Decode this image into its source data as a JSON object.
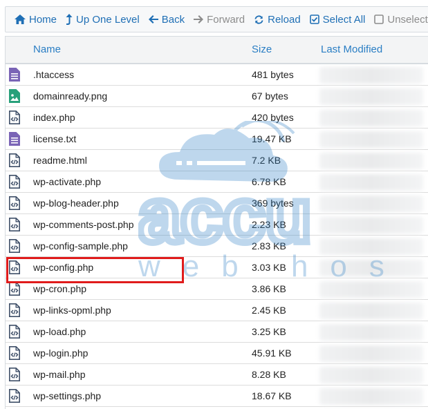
{
  "toolbar": {
    "home": "Home",
    "up": "Up One Level",
    "back": "Back",
    "forward": "Forward",
    "reload": "Reload",
    "select_all": "Select All",
    "unselect": "Unselect All"
  },
  "table": {
    "columns": {
      "name": "Name",
      "size": "Size",
      "modified": "Last Modified"
    },
    "rows": [
      {
        "name": ".htaccess",
        "size": "481 bytes",
        "icon": "text-file-icon"
      },
      {
        "name": "domainready.png",
        "size": "67 bytes",
        "icon": "image-file-icon"
      },
      {
        "name": "index.php",
        "size": "420 bytes",
        "icon": "code-file-icon"
      },
      {
        "name": "license.txt",
        "size": "19.47 KB",
        "icon": "text-file-icon"
      },
      {
        "name": "readme.html",
        "size": "7.2 KB",
        "icon": "code-file-icon"
      },
      {
        "name": "wp-activate.php",
        "size": "6.78 KB",
        "icon": "code-file-icon"
      },
      {
        "name": "wp-blog-header.php",
        "size": "369 bytes",
        "icon": "code-file-icon"
      },
      {
        "name": "wp-comments-post.php",
        "size": "2.23 KB",
        "icon": "code-file-icon"
      },
      {
        "name": "wp-config-sample.php",
        "size": "2.83 KB",
        "icon": "code-file-icon"
      },
      {
        "name": "wp-config.php",
        "size": "3.03 KB",
        "icon": "code-file-icon"
      },
      {
        "name": "wp-cron.php",
        "size": "3.86 KB",
        "icon": "code-file-icon"
      },
      {
        "name": "wp-links-opml.php",
        "size": "2.45 KB",
        "icon": "code-file-icon"
      },
      {
        "name": "wp-load.php",
        "size": "3.25 KB",
        "icon": "code-file-icon"
      },
      {
        "name": "wp-login.php",
        "size": "45.91 KB",
        "icon": "code-file-icon"
      },
      {
        "name": "wp-mail.php",
        "size": "8.28 KB",
        "icon": "code-file-icon"
      },
      {
        "name": "wp-settings.php",
        "size": "18.67 KB",
        "icon": "code-file-icon"
      }
    ]
  },
  "watermark": {
    "brand": "accu",
    "tagline": "web hosting"
  },
  "colors": {
    "link": "#1f6fb5",
    "header_text": "#2a7ec4",
    "text_icon": "#7a64b6",
    "image_icon": "#27a07a",
    "code_icon": "#3f4f68",
    "highlight": "#e01b1b",
    "watermark": "#2a7ec4"
  }
}
